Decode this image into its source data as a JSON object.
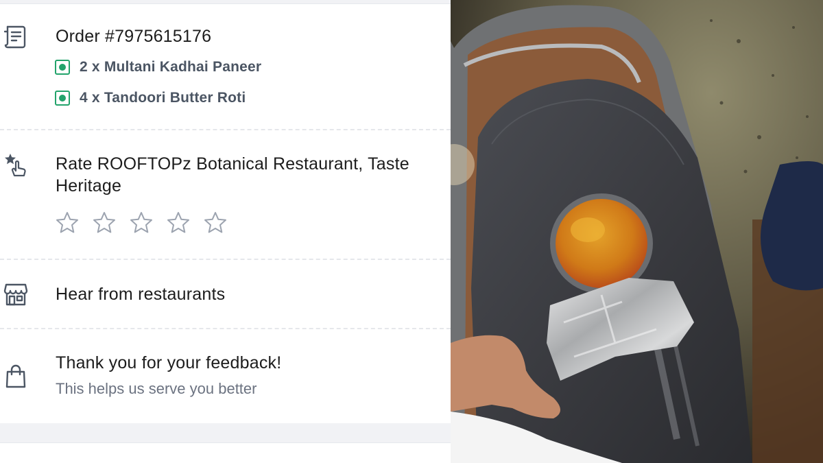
{
  "order": {
    "title": "Order #7975615176",
    "items": [
      {
        "label": "2 x Multani Kadhai Paneer"
      },
      {
        "label": "4 x Tandoori Butter Roti"
      }
    ]
  },
  "rate": {
    "title_line1": "Rate ROOFTOPz Botanical Restaurant, Taste",
    "title_line2": "Heritage",
    "rating": 0,
    "max_rating": 5
  },
  "hear": {
    "title": "Hear from restaurants"
  },
  "feedback": {
    "title": "Thank you for your feedback!",
    "subtitle": "This helps us serve you better"
  },
  "colors": {
    "veg_green": "#22a36b",
    "text_dark": "#1c1c1c",
    "text_muted": "#6b7280",
    "icon": "#4b5563"
  }
}
